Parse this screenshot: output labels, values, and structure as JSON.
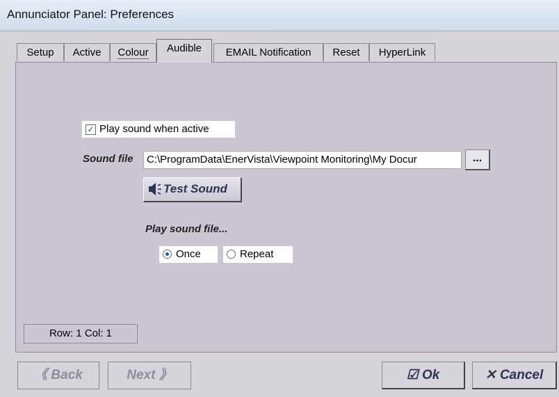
{
  "window": {
    "title": "Annunciator Panel: Preferences"
  },
  "tabs": [
    {
      "label": "Setup"
    },
    {
      "label": "Active"
    },
    {
      "label": "Colour"
    },
    {
      "label": "Audible"
    },
    {
      "label": "EMAIL Notification"
    },
    {
      "label": "Reset"
    },
    {
      "label": "HyperLink"
    }
  ],
  "audible": {
    "play_sound_label": "Play sound when active",
    "play_sound_checked": true,
    "sound_file_label": "Sound file",
    "sound_file_value": "C:\\ProgramData\\EnerVista\\Viewpoint Monitoring\\My Docur",
    "browse_label": "...",
    "test_sound_label": "Test Sound",
    "play_mode_label": "Play sound file...",
    "once_label": "Once",
    "repeat_label": "Repeat",
    "selected_mode": "Once"
  },
  "status": {
    "row_col": "Row: 1  Col: 1"
  },
  "buttons": {
    "back": "Back",
    "next": "Next",
    "ok": "Ok",
    "cancel": "Cancel"
  },
  "icons": {
    "back": "double-chevron-left-icon",
    "next": "double-chevron-right-icon",
    "ok": "check-icon",
    "cancel": "close-icon",
    "test": "speaker-icon"
  }
}
